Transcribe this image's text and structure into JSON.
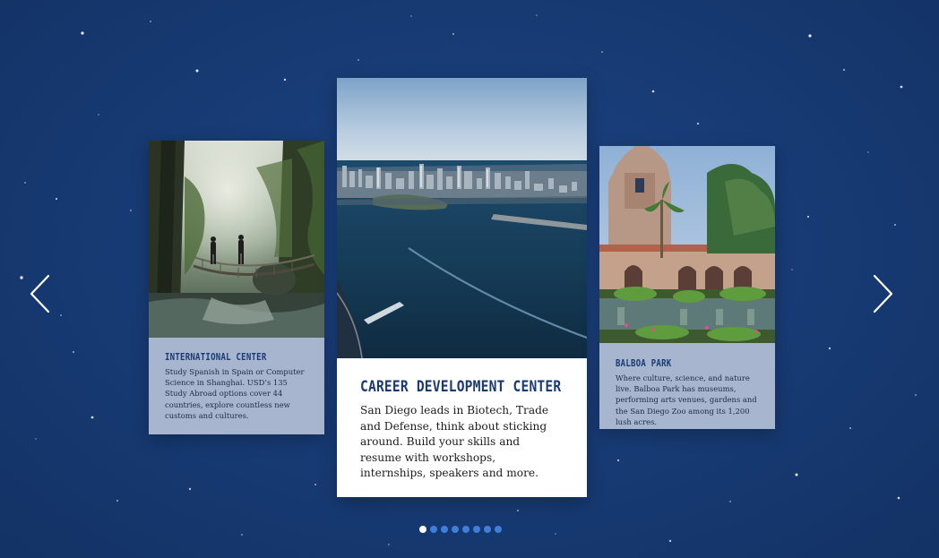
{
  "carousel": {
    "prev_icon": "chevron-left-icon",
    "next_icon": "chevron-right-icon",
    "cards": [
      {
        "title": "INTERNATIONAL CENTER",
        "text": "Study Spanish in Spain or Computer Science in Shanghai. USD’s 135 Study Abroad options cover 44 countries, explore countless new customs and cultures."
      },
      {
        "title": "CAREER DEVELOPMENT CENTER",
        "text": "San Diego leads in Biotech, Trade and Defense, think about sticking around. Build your skills and resume with workshops, internships, speakers and more."
      },
      {
        "title": "BALBOA PARK",
        "text": "Where culture, science, and nature live. Balboa Park has museums, performing arts venues, gardens and the San Diego Zoo among its 1,200 lush acres."
      }
    ],
    "pagination": {
      "total": 8,
      "active_index": 0
    }
  },
  "colors": {
    "background": "#173a73",
    "title": "#1a3a72",
    "side_card_body": "#a7b5cf",
    "dot": "#3f7fd9",
    "dot_active": "#ffffff"
  }
}
